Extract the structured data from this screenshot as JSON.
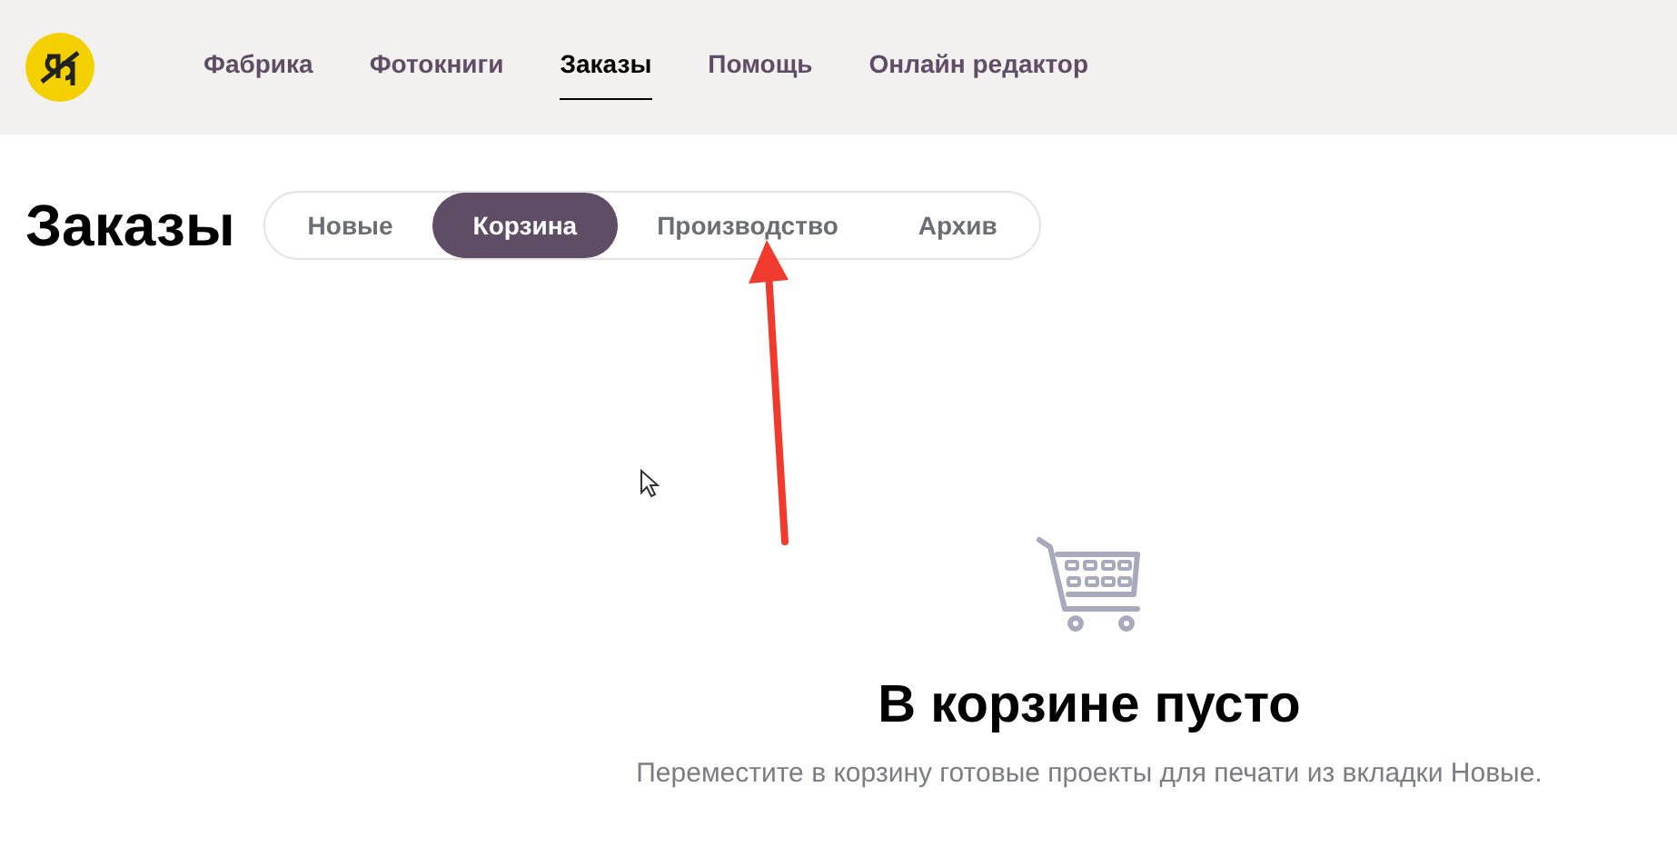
{
  "nav": {
    "items": [
      {
        "label": "Фабрика",
        "selected": false
      },
      {
        "label": "Фотокниги",
        "selected": false
      },
      {
        "label": "Заказы",
        "selected": true
      },
      {
        "label": "Помощь",
        "selected": false
      },
      {
        "label": "Онлайн редактор",
        "selected": false
      }
    ]
  },
  "page": {
    "title": "Заказы",
    "tabs": [
      {
        "label": "Новые",
        "selected": false
      },
      {
        "label": "Корзина",
        "selected": true
      },
      {
        "label": "Производство",
        "selected": false
      },
      {
        "label": "Архив",
        "selected": false
      }
    ]
  },
  "empty_state": {
    "title": "В корзине пусто",
    "message": "Переместите в корзину готовые проекты для печати из вкладки Новые."
  }
}
